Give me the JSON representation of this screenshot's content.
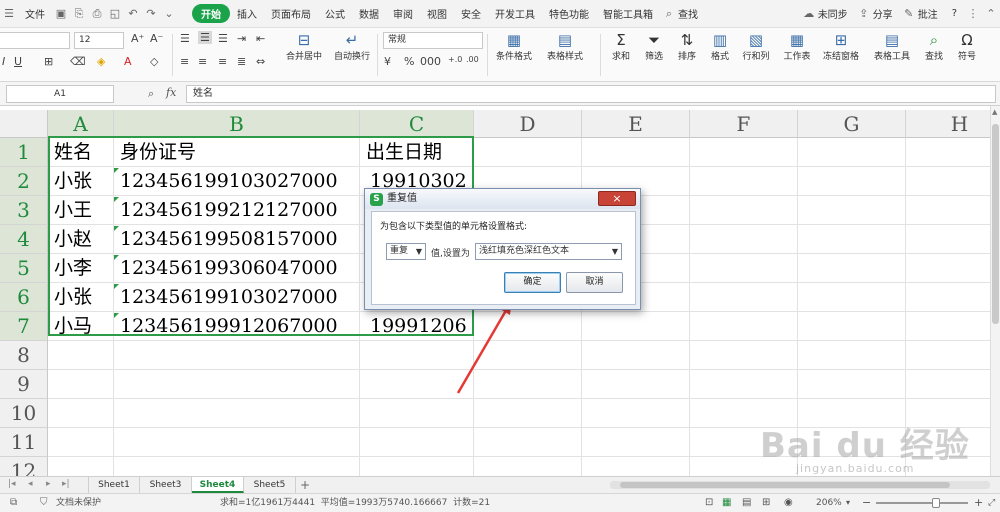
{
  "menubar": {
    "file": "文件",
    "tabs": [
      "开始",
      "插入",
      "页面布局",
      "公式",
      "数据",
      "审阅",
      "视图",
      "安全",
      "开发工具",
      "特色功能",
      "智能工具箱"
    ],
    "search": "查找",
    "sync": "未同步",
    "share": "分享",
    "comment": "批注",
    "help": "?"
  },
  "ribbon": {
    "font_size": "12",
    "number_format": "常规",
    "merge": "合并居中",
    "wrap": "自动换行",
    "conditional": "条件格式",
    "table_style": "表格样式",
    "sum": "求和",
    "filter": "筛选",
    "sort": "排序",
    "format": "格式",
    "rowcol": "行和列",
    "sheet": "工作表",
    "freeze": "冻结窗格",
    "table_tools": "表格工具",
    "find": "查找",
    "symbol": "符号"
  },
  "formula": {
    "cell_ref": "A1",
    "content": "姓名"
  },
  "grid": {
    "columns": [
      "A",
      "B",
      "C",
      "D",
      "E",
      "F",
      "G",
      "H"
    ],
    "rows": [
      "1",
      "2",
      "3",
      "4",
      "5",
      "6",
      "7",
      "8",
      "9",
      "10",
      "11",
      "12"
    ],
    "data": [
      [
        "姓名",
        "身份证号",
        "出生日期"
      ],
      [
        "小张",
        "123456199103027000",
        "19910302"
      ],
      [
        "小王",
        "123456199212127000",
        ""
      ],
      [
        "小赵",
        "123456199508157000",
        ""
      ],
      [
        "小李",
        "123456199306047000",
        ""
      ],
      [
        "小张",
        "123456199103027000",
        ""
      ],
      [
        "小马",
        "123456199912067000",
        "19991206"
      ]
    ]
  },
  "sheets": {
    "tabs": [
      "Sheet1",
      "Sheet3",
      "Sheet4",
      "Sheet5"
    ],
    "active": "Sheet4",
    "add": "+"
  },
  "status": {
    "protect": "文档未保护",
    "stats": "求和=1亿1961万4441  平均值=1993万5740.166667  计数=21",
    "zoom": "206%"
  },
  "dialog": {
    "title": "重复值",
    "close": "×",
    "prompt": "为包含以下类型值的单元格设置格式:",
    "type_value": "重复",
    "mid_label": "值,设置为",
    "format_value": "浅红填充色深红色文本",
    "ok": "确定",
    "cancel": "取消"
  },
  "watermark": {
    "main": "Bai du 经验",
    "sub": "jingyan.baidu.com"
  },
  "colors": {
    "accent": "#1aa34a",
    "selection": "#2d9b47",
    "arrow": "#e53935"
  }
}
